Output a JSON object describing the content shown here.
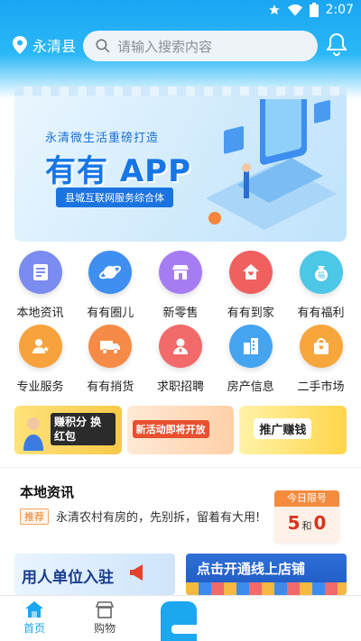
{
  "status": {
    "time": "2:07"
  },
  "header": {
    "location": "永清县",
    "search_placeholder": "请输入搜索内容"
  },
  "banner": {
    "slogan": "永清微生活重磅打造",
    "title": "有有 APP",
    "subtitle": "县城互联网服务综合体"
  },
  "grid": [
    [
      {
        "label": "本地资讯",
        "icon": "news-icon",
        "color": "#7b8cf0"
      },
      {
        "label": "有有圈儿",
        "icon": "planet-icon",
        "color": "#3f8ff0"
      },
      {
        "label": "新零售",
        "icon": "store-icon",
        "color": "#a67cf2"
      },
      {
        "label": "有有到家",
        "icon": "home-icon",
        "color": "#f0605e"
      },
      {
        "label": "有有福利",
        "icon": "gift-bag-icon",
        "color": "#4cc7e6"
      }
    ],
    [
      {
        "label": "专业服务",
        "icon": "service-icon",
        "color": "#f7a23c"
      },
      {
        "label": "有有捎货",
        "icon": "truck-icon",
        "color": "#f58b46"
      },
      {
        "label": "求职招聘",
        "icon": "recruit-icon",
        "color": "#f26a6a"
      },
      {
        "label": "房产信息",
        "icon": "building-icon",
        "color": "#45a4f0"
      },
      {
        "label": "二手市场",
        "icon": "market-icon",
        "color": "#f7a63c"
      }
    ]
  ],
  "promos": {
    "p1": "赚积分 换红包",
    "p2": "新活动即将开放",
    "p3": "推广赚钱"
  },
  "news": {
    "title": "本地资讯",
    "tag": "推荐",
    "headline": "永清农村有房的，先别拆，留着有大用!"
  },
  "limit": {
    "head": "今日限号",
    "a": "5",
    "and": "和",
    "b": "0"
  },
  "bottom_banners": {
    "b1": "用人单位入驻",
    "b2": "点击开通线上店铺"
  },
  "tabs": [
    {
      "label": "首页",
      "active": true
    },
    {
      "label": "购物",
      "active": false
    }
  ],
  "colors": {
    "accent": "#1aa6f2",
    "tag": "#f07c22"
  }
}
